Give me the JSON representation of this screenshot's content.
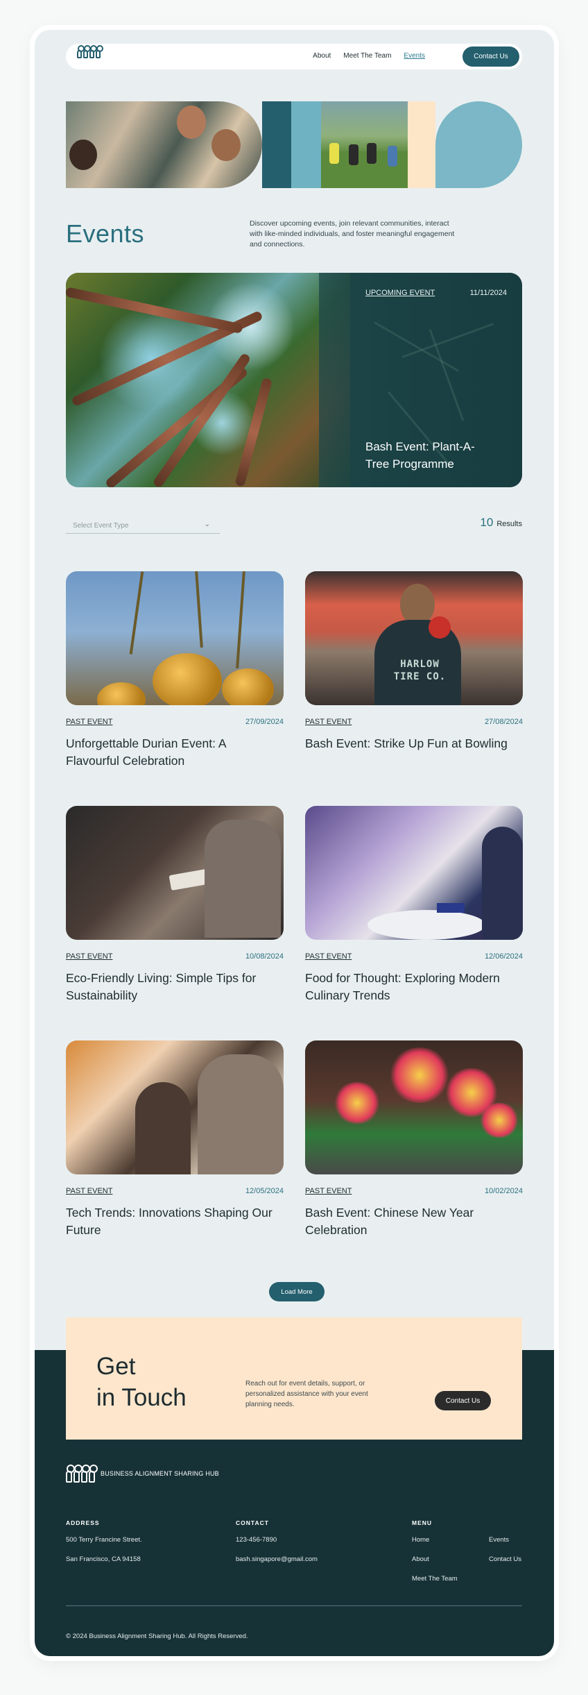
{
  "nav": {
    "links": [
      {
        "label": "About"
      },
      {
        "label": "Meet The Team"
      },
      {
        "label": "Events"
      }
    ],
    "cta": "Contact Us"
  },
  "page": {
    "title": "Events",
    "intro": "Discover upcoming events, join relevant communities, interact with like-minded individuals, and foster meaningful engagement and connections."
  },
  "featured": {
    "tag": "UPCOMING EVENT",
    "date": "11/11/2024",
    "title": "Bash Event: Plant-A-Tree Programme"
  },
  "filter": {
    "placeholder": "Select Event Type",
    "results_count": "10",
    "results_label": "Results"
  },
  "events": [
    {
      "tag": "PAST EVENT",
      "date": "27/09/2024",
      "title": "Unforgettable Durian Event: A Flavourful Celebration"
    },
    {
      "tag": "PAST EVENT",
      "date": "27/08/2024",
      "title": "Bash Event: Strike Up Fun at Bowling",
      "image_text": "HARLOW TIRE CO."
    },
    {
      "tag": "PAST EVENT",
      "date": "10/08/2024",
      "title": "Eco-Friendly Living: Simple Tips for Sustainability"
    },
    {
      "tag": "PAST EVENT",
      "date": "12/06/2024",
      "title": "Food for Thought: Exploring Modern Culinary Trends"
    },
    {
      "tag": "PAST EVENT",
      "date": "12/05/2024",
      "title": "Tech Trends: Innovations Shaping Our Future"
    },
    {
      "tag": "PAST EVENT",
      "date": "10/02/2024",
      "title": "Bash Event: Chinese New Year Celebration"
    }
  ],
  "load_more": "Load More",
  "touch": {
    "heading_line1": "Get",
    "heading_line2": "in Touch",
    "text": "Reach out for event details, support, or personalized assistance with your event planning needs.",
    "cta": "Contact Us"
  },
  "footer": {
    "brand": "BUSINESS ALIGNMENT SHARING HUB",
    "address_heading": "ADDRESS",
    "address_line1": "500 Terry Francine Street.",
    "address_line2": "San Francisco, CA 94158",
    "contact_heading": "CONTACT",
    "phone": "123-456-7890",
    "email": "bash.singapore@gmail.com",
    "menu_heading": "MENU",
    "menu": [
      "Home",
      "Events",
      "About",
      "Contact Us",
      "Meet The Team"
    ],
    "copyright": "© 2024 Business Alignment Sharing Hub. All Rights Reserved."
  },
  "colors": {
    "primary": "#245f6e",
    "accent": "#2a7a8c",
    "peach": "#fde6cc",
    "footer": "#173237",
    "background": "#e9eff1"
  }
}
